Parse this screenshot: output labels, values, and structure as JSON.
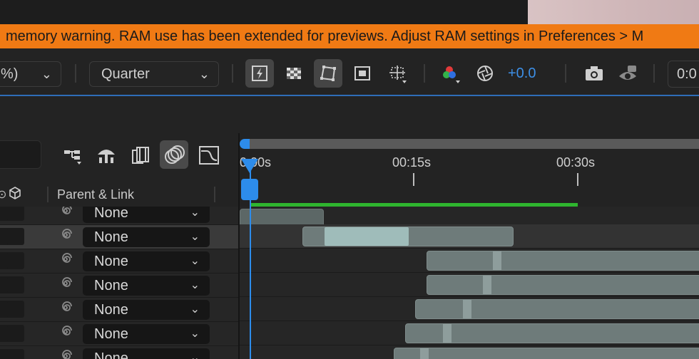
{
  "warning": {
    "text": "memory warning. RAM use has been extended for previews. Adjust RAM settings in Preferences > M"
  },
  "toolbar": {
    "magnification_value": "%)",
    "resolution_value": "Quarter",
    "exposure_value": "+0.0",
    "timecode_partial": "0:0",
    "icons": [
      "fast-previews-icon",
      "transparency-grid-icon",
      "mask-path-visibility-icon",
      "region-of-interest-icon",
      "grid-guides-icon",
      "color-channels-icon",
      "color-management-icon",
      "snapshot-camera-icon",
      "show-snapshot-icon"
    ]
  },
  "layer_panel": {
    "column_header": "Parent & Link",
    "switch_icons": [
      "composition-flowchart-icon",
      "draft-3d-icon",
      "frame-blending-icon",
      "motion-blur-icon",
      "graph-editor-icon"
    ],
    "rows": [
      {
        "parent": "None",
        "selected": false
      },
      {
        "parent": "None",
        "selected": true
      },
      {
        "parent": "None",
        "selected": false
      },
      {
        "parent": "None",
        "selected": false
      },
      {
        "parent": "None",
        "selected": false
      },
      {
        "parent": "None",
        "selected": false
      },
      {
        "parent": "None",
        "selected": false
      }
    ]
  },
  "timeline": {
    "ruler_labels": [
      "0:00s",
      "00:15s",
      "00:30s"
    ],
    "accent_color": "#2d8ceb",
    "work_area_color": "#2fb52f"
  }
}
